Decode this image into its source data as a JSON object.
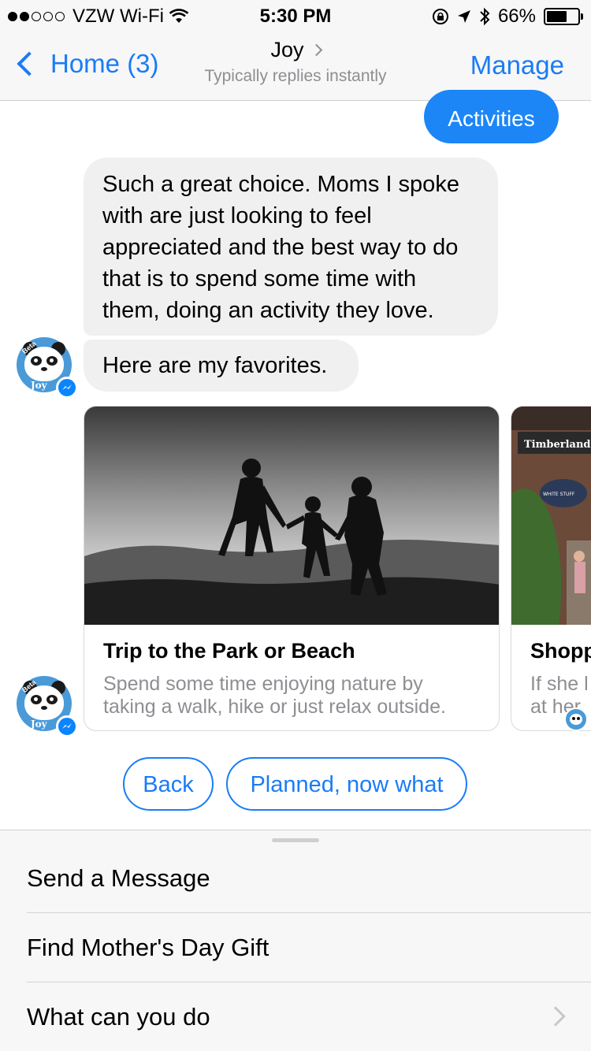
{
  "status_bar": {
    "carrier": "VZW Wi-Fi",
    "time": "5:30 PM",
    "battery": "66%",
    "battery_level": 0.66,
    "signal_bars_filled": 2,
    "icons": [
      "signal-dots-icon",
      "wifi-icon",
      "orientation-lock-icon",
      "location-icon",
      "bluetooth-icon",
      "battery-icon"
    ]
  },
  "nav": {
    "back_label": "Home (3)",
    "title": "Joy",
    "subtitle": "Typically replies instantly",
    "manage_label": "Manage"
  },
  "chat": {
    "sent_chip": "Activities",
    "messages": [
      "Such a great choice. Moms I spoke with are just looking to feel appreciated and the best way to do that is to spend some time with them, doing an activity they love.",
      "Here are my favorites."
    ],
    "avatar_text": "Joy",
    "avatar_badge": "Beta",
    "cards": [
      {
        "title": "Trip to the Park or Beach",
        "desc_line1": "Spend some time enjoying nature by",
        "desc_line2": "taking a walk, hike or just relax outside."
      },
      {
        "title": "Shopp",
        "desc_line1": "If she l",
        "desc_line2": "at her",
        "img_sign": "Timberland",
        "img_sign2": "WHITE STUFF"
      }
    ]
  },
  "quick_replies": {
    "back": "Back",
    "planned": "Planned, now what"
  },
  "menu": {
    "items": [
      "Send a Message",
      "Find Mother's Day Gift",
      "What can you do"
    ]
  },
  "colors": {
    "accent": "#1a7cf5",
    "bubble_gray": "#f0f0f0",
    "chip_blue": "#1c86f7"
  }
}
